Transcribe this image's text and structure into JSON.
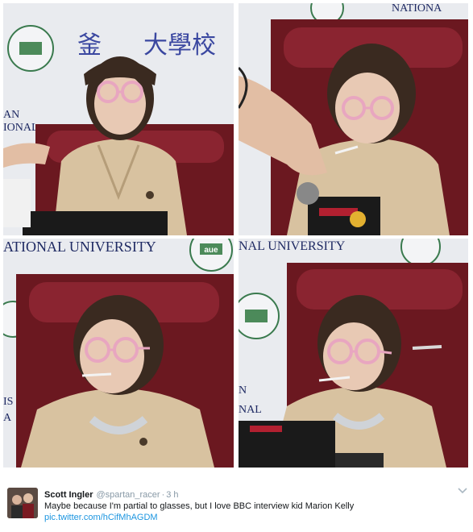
{
  "photos": {
    "panel_1": {
      "banner_cjk": "釜 大學校",
      "banner_latin": "AN\nIONAL"
    },
    "panel_2": {
      "banner_latin": "NATIONA"
    },
    "panel_3": {
      "banner_latin": "ATIONAL UNIVERSITY",
      "logo_text": "aue"
    },
    "panel_4": {
      "banner_latin": "NAL UNIVERSITY"
    }
  },
  "tweet": {
    "author_name": "Scott Ingler",
    "author_handle": "@spartan_racer",
    "separator": "·",
    "timestamp": "3 h",
    "text": "Maybe because I'm partial to glasses, but I love BBC interview kid Marion Kelly",
    "link": "pic.twitter.com/hCifMhAGDM",
    "menu_icon": "chevron-down-icon"
  },
  "colors": {
    "link": "#1b95e0",
    "handle": "#8899a6",
    "chair": "#7a1a22",
    "coat": "#d8c2a0",
    "glasses": "#e8a6c0"
  }
}
